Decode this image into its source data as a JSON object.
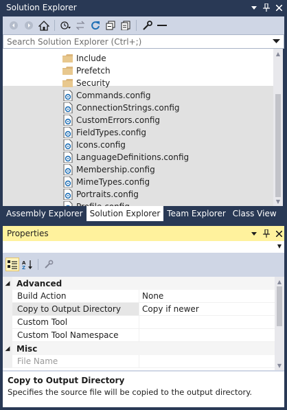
{
  "solution_explorer": {
    "title": "Solution Explorer",
    "search_placeholder": "Search Solution Explorer (Ctrl+;)",
    "toolbar": [
      "back-icon",
      "forward-icon",
      "home-icon",
      "history-icon",
      "sync-icon",
      "refresh-icon",
      "collapse-all-icon",
      "show-all-files-icon",
      "properties-icon",
      "preview-icon"
    ],
    "items": [
      {
        "label": "Include",
        "icon": "folder-icon"
      },
      {
        "label": "Prefetch",
        "icon": "folder-icon"
      },
      {
        "label": "Security",
        "icon": "folder-icon"
      },
      {
        "label": "Commands.config",
        "icon": "config-file-icon"
      },
      {
        "label": "ConnectionStrings.config",
        "icon": "config-file-icon"
      },
      {
        "label": "CustomErrors.config",
        "icon": "config-file-icon"
      },
      {
        "label": "FieldTypes.config",
        "icon": "config-file-icon"
      },
      {
        "label": "Icons.config",
        "icon": "config-file-icon"
      },
      {
        "label": "LanguageDefinitions.config",
        "icon": "config-file-icon"
      },
      {
        "label": "Membership.config",
        "icon": "config-file-icon"
      },
      {
        "label": "MimeTypes.config",
        "icon": "config-file-icon"
      },
      {
        "label": "Portraits.config",
        "icon": "config-file-icon"
      },
      {
        "label": "Profile.config",
        "icon": "config-file-icon"
      }
    ],
    "tabs": [
      {
        "label": "Assembly Explorer",
        "active": false
      },
      {
        "label": "Solution Explorer",
        "active": true
      },
      {
        "label": "Team Explorer",
        "active": false
      },
      {
        "label": "Class View",
        "active": false
      }
    ]
  },
  "properties": {
    "title": "Properties",
    "object_selector_value": "",
    "categories": [
      {
        "name": "Advanced",
        "rows": [
          {
            "name": "Build Action",
            "value": "None"
          },
          {
            "name": "Copy to Output Directory",
            "value": "Copy if newer"
          },
          {
            "name": "Custom Tool",
            "value": ""
          },
          {
            "name": "Custom Tool Namespace",
            "value": ""
          }
        ]
      },
      {
        "name": "Misc",
        "rows": [
          {
            "name": "File Name",
            "value": ""
          }
        ]
      }
    ],
    "description": {
      "title": "Copy to Output Directory",
      "text": "Specifies the source file will be copied to the output directory."
    }
  },
  "colors": {
    "chrome": "#293955",
    "toolbar": "#cfd6e5",
    "active_title": "#fff29d",
    "selection_band": "#e1e1e1",
    "folder": "#dcb67a",
    "config_icon": "#1f6fb5"
  }
}
